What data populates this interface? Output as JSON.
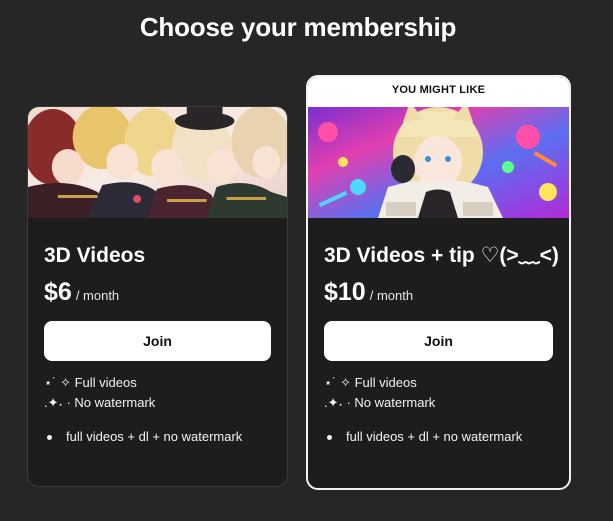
{
  "page": {
    "title": "Choose your membership"
  },
  "tiers": [
    {
      "name": "3D Videos",
      "price": "$6",
      "period": "/ month",
      "join_label": "Join",
      "benefit_lines": [
        "⋆˙ ✧ Full videos",
        ".✦˖ · No watermark"
      ],
      "bullets": [
        "full videos + dl + no watermark"
      ],
      "image": "anime-group-illustration"
    },
    {
      "badge": "YOU MIGHT LIKE",
      "name": "3D Videos + tip ♡(>﹏<)",
      "price": "$10",
      "period": "/ month",
      "join_label": "Join",
      "benefit_lines": [
        "⋆˙ ✧ Full videos",
        ".✦˖ · No watermark"
      ],
      "bullets": [
        "full videos + dl + no watermark"
      ],
      "image": "anime-character-colorful-splash"
    }
  ],
  "colors": {
    "background": "#262626",
    "card": "#1d1d1d",
    "button": "#ffffff",
    "featured_border": "#f2f2f2"
  }
}
